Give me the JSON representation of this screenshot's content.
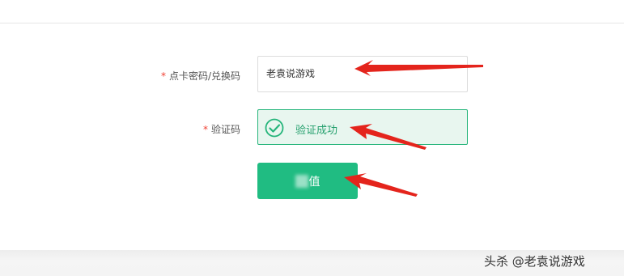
{
  "form": {
    "card_field": {
      "required_mark": "*",
      "label": "点卡密码/兑换码",
      "value": "老袁说游戏"
    },
    "captcha_field": {
      "required_mark": "*",
      "label": "验证码",
      "status_text": "验证成功",
      "status_icon": "check-circle-icon"
    },
    "submit_button": {
      "label": "值"
    }
  },
  "watermark": {
    "text": "头杀 @老袁说游戏"
  },
  "colors": {
    "accent_green": "#20bc82",
    "success_bg": "#e8f6ef",
    "success_border": "#26b57b",
    "required_red": "#f04134",
    "annotation_arrow": "#e4241c"
  }
}
